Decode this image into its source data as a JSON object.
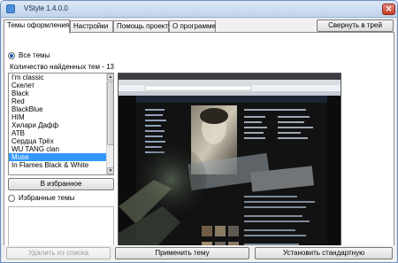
{
  "window": {
    "title": "VStyle 1.4.0.0",
    "close_glyph": "✕"
  },
  "tabs": [
    {
      "label": "Темы оформления",
      "active": true
    },
    {
      "label": "Настройки",
      "active": false
    },
    {
      "label": "Помощь проекту",
      "active": false
    },
    {
      "label": "О программе",
      "active": false
    }
  ],
  "tray_button": "Свернуть в трей",
  "all_themes": {
    "label": "Все темы",
    "checked": true,
    "count_label": "Количество найденных тем - 13",
    "items": [
      "I'm classic",
      "Скелет",
      "Black",
      "Red",
      "BlackBlue",
      "HIM",
      "Хилари Дафф",
      "ATB",
      "Сердца Трёх",
      "WU TANG clan",
      "Muse",
      "In Flames Black & White"
    ],
    "selected": "Muse"
  },
  "favorite_button": "В избранное",
  "favorites": {
    "label": "Избранные темы",
    "checked": false
  },
  "preview": {
    "icon": "theme-preview-image"
  },
  "buttons": {
    "remove": "Удалить из списка",
    "apply": "Применить тему",
    "default": "Установить стандартную"
  },
  "colors": {
    "selection": "#3399ff",
    "preview_bg": "#0c0c0c"
  }
}
